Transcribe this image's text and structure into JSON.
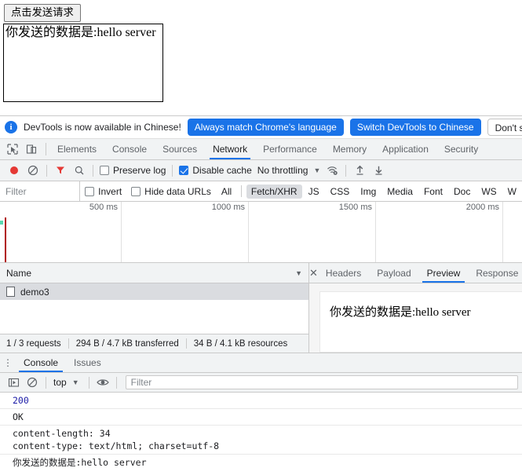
{
  "page": {
    "send_button_label": "点击发送请求",
    "result_text": "你发送的数据是:hello server"
  },
  "infobar": {
    "icon": "info-icon",
    "message": "DevTools is now available in Chinese!",
    "primary_button": "Always match Chrome's language",
    "secondary_button": "Switch DevTools to Chinese",
    "dismiss_button": "Don't show again"
  },
  "main_tabs": {
    "inspect_icon": "inspect-element-icon",
    "device_icon": "device-toolbar-icon",
    "items": [
      {
        "label": "Elements",
        "active": false
      },
      {
        "label": "Console",
        "active": false
      },
      {
        "label": "Sources",
        "active": false
      },
      {
        "label": "Network",
        "active": true
      },
      {
        "label": "Performance",
        "active": false
      },
      {
        "label": "Memory",
        "active": false
      },
      {
        "label": "Application",
        "active": false
      },
      {
        "label": "Security",
        "active": false
      }
    ]
  },
  "network_toolbar": {
    "record_icon": "record-button-icon",
    "clear_icon": "clear-icon",
    "filter_icon": "filter-funnel-icon",
    "search_icon": "search-icon",
    "preserve_log_label": "Preserve log",
    "preserve_log_checked": false,
    "disable_cache_label": "Disable cache",
    "disable_cache_checked": true,
    "throttling_label": "No throttling",
    "throttling_caret": "▼",
    "network_conditions_icon": "network-conditions-wifi-icon",
    "import_icon": "import-har-icon",
    "export_icon": "export-har-icon"
  },
  "filter_bar": {
    "filter_placeholder": "Filter",
    "invert_label": "Invert",
    "invert_checked": false,
    "hide_data_urls_label": "Hide data URLs",
    "hide_data_urls_checked": false,
    "types": [
      {
        "label": "All",
        "active": false
      },
      {
        "label": "Fetch/XHR",
        "active": true
      },
      {
        "label": "JS",
        "active": false
      },
      {
        "label": "CSS",
        "active": false
      },
      {
        "label": "Img",
        "active": false
      },
      {
        "label": "Media",
        "active": false
      },
      {
        "label": "Font",
        "active": false
      },
      {
        "label": "Doc",
        "active": false
      },
      {
        "label": "WS",
        "active": false
      },
      {
        "label": "W",
        "active": false
      }
    ]
  },
  "overview": {
    "ticks": [
      "500 ms",
      "1000 ms",
      "1500 ms",
      "2000 ms"
    ]
  },
  "requests": {
    "column_header": "Name",
    "sort_caret": "▼",
    "rows": [
      {
        "name": "demo3",
        "icon": "document-icon",
        "selected": true
      }
    ],
    "status": {
      "requests": "1 / 3 requests",
      "transferred": "294 B / 4.7 kB transferred",
      "resources": "34 B / 4.1 kB resources"
    }
  },
  "detail": {
    "close_icon": "close-icon",
    "tabs": [
      {
        "label": "Headers",
        "active": false
      },
      {
        "label": "Payload",
        "active": false
      },
      {
        "label": "Preview",
        "active": true
      },
      {
        "label": "Response",
        "active": false
      }
    ],
    "preview_text": "你发送的数据是:hello server"
  },
  "drawer": {
    "menu_icon": "more-options-icon",
    "tabs": [
      {
        "label": "Console",
        "active": true
      },
      {
        "label": "Issues",
        "active": false
      }
    ],
    "toolbar": {
      "sidebar_icon": "console-sidebar-icon",
      "clear_icon": "clear-console-icon",
      "context_label": "top",
      "context_caret": "▼",
      "eye_icon": "live-expression-eye-icon",
      "filter_placeholder": "Filter"
    },
    "log_rows": [
      {
        "text": "200",
        "kind": "num"
      },
      {
        "text": "OK",
        "kind": "text"
      },
      {
        "text": "content-length: 34\ncontent-type: text/html; charset=utf-8",
        "kind": "text"
      },
      {
        "text": "你发送的数据是:hello server",
        "kind": "text"
      }
    ]
  },
  "colors": {
    "accent": "#1a73e8",
    "record_red": "#e53935",
    "toolbar_bg": "#f1f3f4",
    "selected_row": "#dadce0",
    "console_number": "#1a1aa6"
  }
}
